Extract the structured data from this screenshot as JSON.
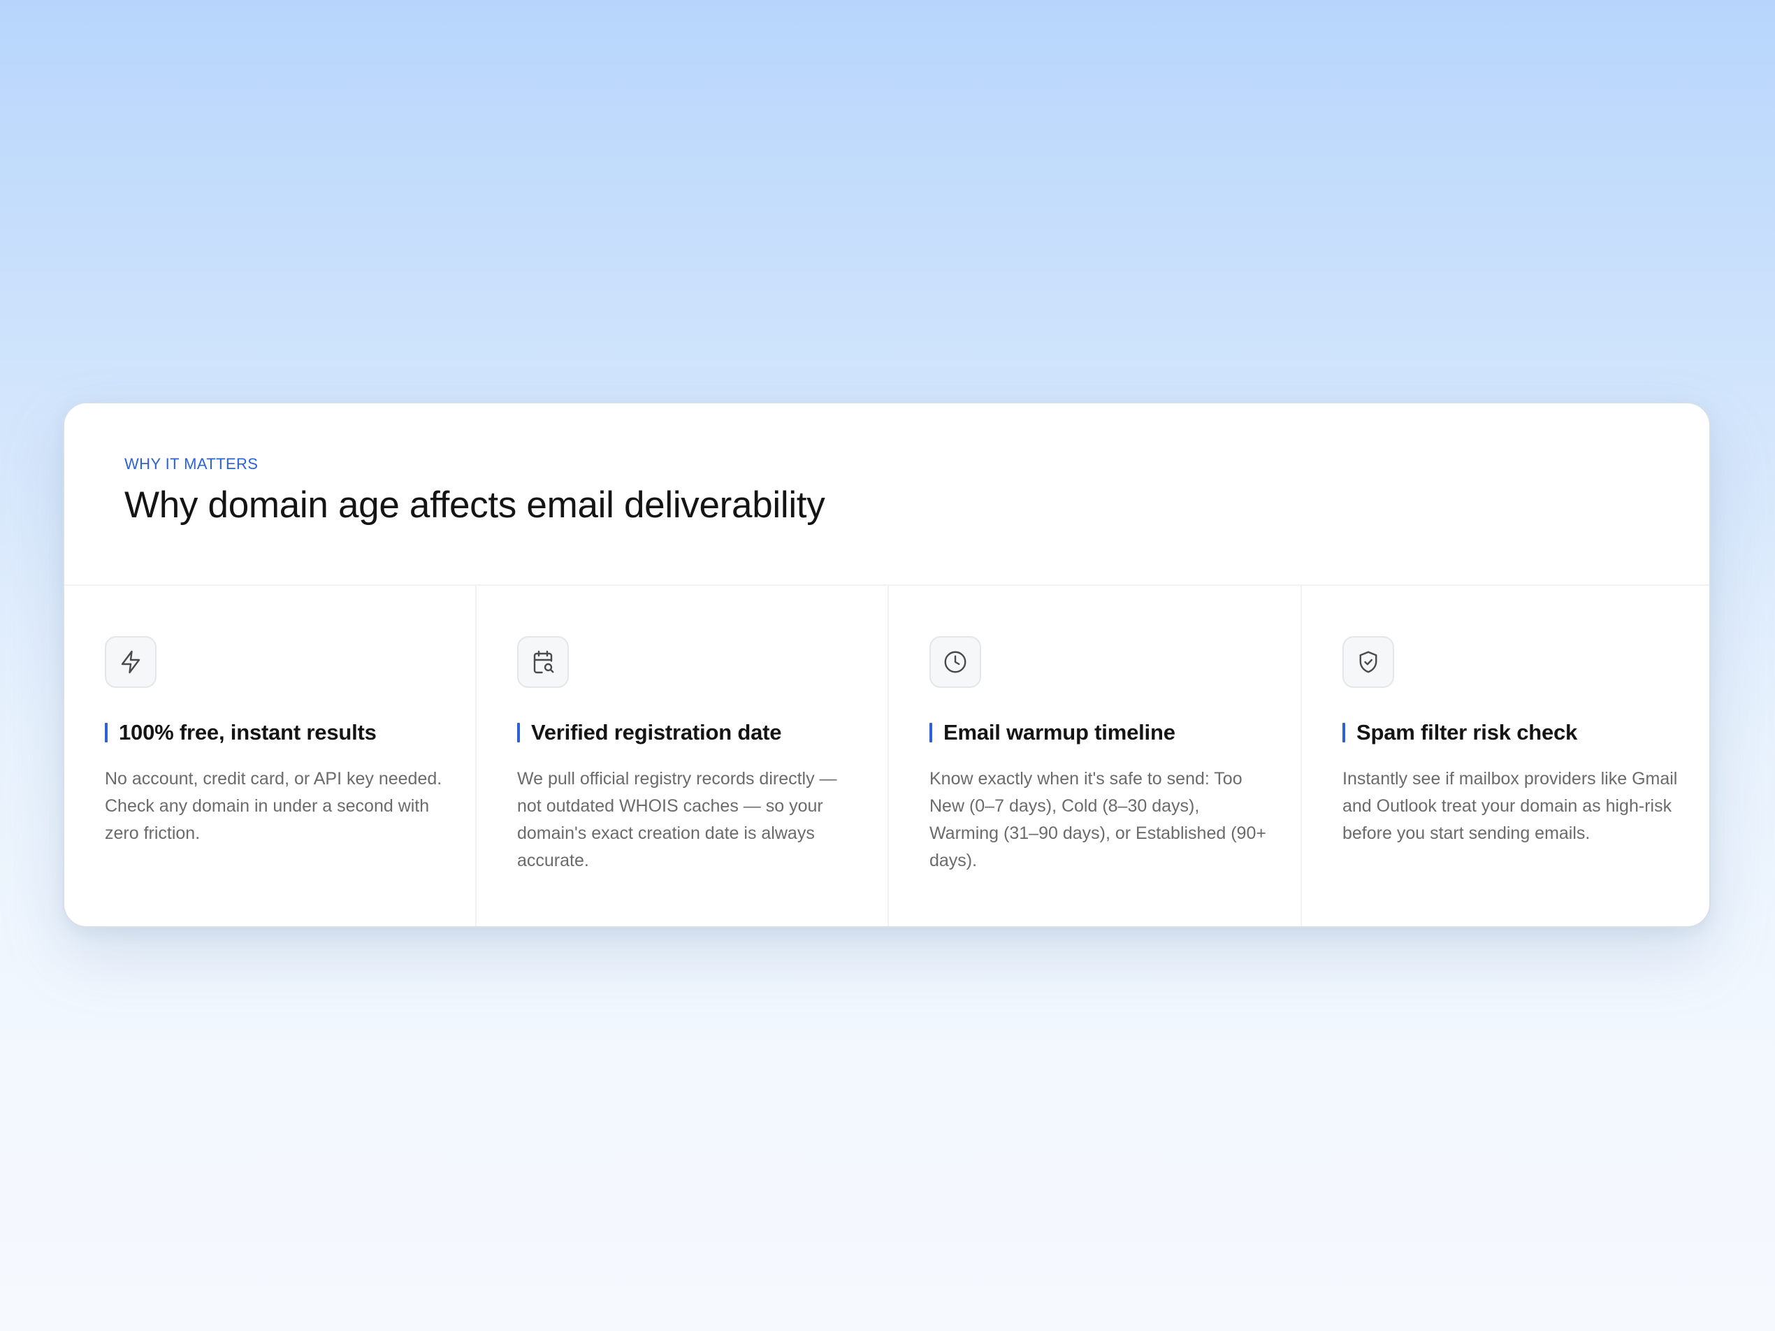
{
  "section": {
    "eyebrow": "WHY IT MATTERS",
    "title": "Why domain age affects email deliverability"
  },
  "features": [
    {
      "icon": "lightning-icon",
      "title": "100% free, instant results",
      "description": "No account, credit card, or API key needed. Check any domain in under a second with zero friction."
    },
    {
      "icon": "calendar-search-icon",
      "title": "Verified registration date",
      "description": "We pull official registry records directly — not outdated WHOIS caches — so your domain's exact creation date is always accurate."
    },
    {
      "icon": "clock-icon",
      "title": "Email warmup timeline",
      "description": "Know exactly when it's safe to send: Too New (0–7 days), Cold (8–30 days), Warming (31–90 days), or Established (90+ days)."
    },
    {
      "icon": "shield-check-icon",
      "title": "Spam filter risk check",
      "description": "Instantly see if mailbox providers like Gmail and Outlook treat your domain as high-risk before you start sending emails."
    }
  ],
  "colors": {
    "accent": "#2b62d6",
    "heading": "#141414",
    "body_text": "#6b6b6b",
    "background_top": "#b7d5fc",
    "background_bottom": "#f6f9fe"
  }
}
